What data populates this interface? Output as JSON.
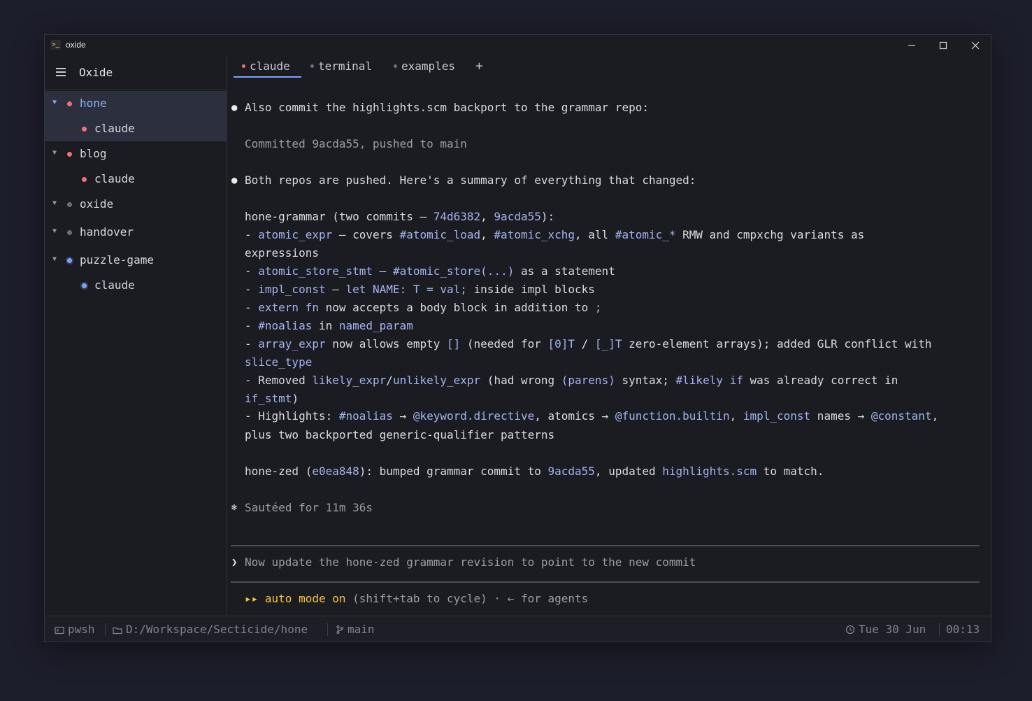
{
  "window": {
    "app_icon": ">_",
    "title": "oxide"
  },
  "sidebar": {
    "title": "Oxide",
    "tree": [
      {
        "label": "hone",
        "dot_color": "#f07178",
        "selected": true
      },
      {
        "label": "claude",
        "dot_color": "#f07178"
      },
      {
        "label": "blog",
        "dot_color": "#f07178"
      },
      {
        "label": "claude",
        "dot_color": "#f07178"
      },
      {
        "label": "oxide",
        "dot_color": "#6b6e7a"
      },
      {
        "label": "handover",
        "dot_color": "#6b6e7a"
      },
      {
        "label": "puzzle-game",
        "dot_color": "#7aa2f7"
      },
      {
        "label": "claude",
        "dot_color": "#7aa2f7"
      }
    ]
  },
  "tabs": {
    "items": [
      {
        "label": "claude",
        "dot_color": "#f07178",
        "active": true
      },
      {
        "label": "terminal",
        "dot_color": "#6b6e7a"
      },
      {
        "label": "examples",
        "dot_color": "#6b6e7a"
      }
    ],
    "add_label": "+"
  },
  "transcript": {
    "l1_bullet": "●",
    "l1": "Also commit the highlights.scm backport to the grammar repo:",
    "l2": "Committed 9acda55, pushed to main",
    "l3_bullet": "●",
    "l3": "Both repos are pushed. Here's a summary of everything that changed:",
    "g_a": "hone-grammar (two commits — ",
    "g_b": "74d6382",
    "g_c": ", ",
    "g_d": "9acda55",
    "g_e": "):",
    "b1_a": "- ",
    "b1_b": "atomic_expr",
    "b1_c": " — covers ",
    "b1_d": "#atomic_load",
    "b1_e": ", ",
    "b1_f": "#atomic_xchg",
    "b1_g": ", all ",
    "b1_h": "#atomic_*",
    "b1_i": " RMW and cmpxchg variants as",
    "b1_cont": "expressions",
    "b2_a": "- ",
    "b2_b": "atomic_store_stmt",
    "b2_c": " — ",
    "b2_d": "#atomic_store(...)",
    "b2_e": " as a statement",
    "b3_a": "- ",
    "b3_b": "impl_const",
    "b3_c": " — ",
    "b3_d": "let NAME: T = val;",
    "b3_e": " inside impl blocks",
    "b4_a": "- ",
    "b4_b": "extern fn",
    "b4_c": " now accepts a body block in addition to ",
    "b4_d": ";",
    "b5_a": "- ",
    "b5_b": "#noalias",
    "b5_c": " in ",
    "b5_d": "named_param",
    "b6_a": "- ",
    "b6_b": "array_expr",
    "b6_c": " now allows empty ",
    "b6_d": "[]",
    "b6_e": " (needed for ",
    "b6_f": "[0]T",
    "b6_g": " / ",
    "b6_h": "[_]T",
    "b6_i": " zero-element arrays); added GLR conflict with",
    "b6_cont": "slice_type",
    "b7_a": "- Removed ",
    "b7_b": "likely_expr",
    "b7_c": "/",
    "b7_d": "unlikely_expr",
    "b7_e": " (had wrong ",
    "b7_f": "(parens)",
    "b7_g": " syntax; ",
    "b7_h": "#likely if",
    "b7_i": " was already correct in",
    "b7_cont_a": "if_stmt",
    "b7_cont_b": ")",
    "b8_a": "- Highlights: ",
    "b8_b": "#noalias",
    "b8_c": " → ",
    "b8_d": "@keyword.directive",
    "b8_e": ", atomics → ",
    "b8_f": "@function.builtin",
    "b8_g": ", ",
    "b8_h": "impl_const",
    "b8_i": " names → ",
    "b8_j": "@constant",
    "b8_k": ",",
    "b8_cont": "plus two backported generic-qualifier patterns",
    "z_a": "hone-zed (",
    "z_b": "e0ea848",
    "z_c": "): bumped grammar commit to ",
    "z_d": "9acda55",
    "z_e": ", updated ",
    "z_f": "highlights.scm",
    "z_g": " to match.",
    "timer_icon": "✻",
    "timer": "Sautéed for 11m 36s"
  },
  "prompt": {
    "arrow": "❯",
    "input": "Now update the hone-zed grammar revision to point to the new commit"
  },
  "mode": {
    "arrows": "▸▸",
    "label": "auto mode on",
    "hint": " (shift+tab to cycle) · ← for agents"
  },
  "status": {
    "shell": "pwsh",
    "path": "D:/Workspace/Secticide/hone",
    "branch": "main",
    "date": "Tue 30 Jun",
    "time": "00:13"
  }
}
